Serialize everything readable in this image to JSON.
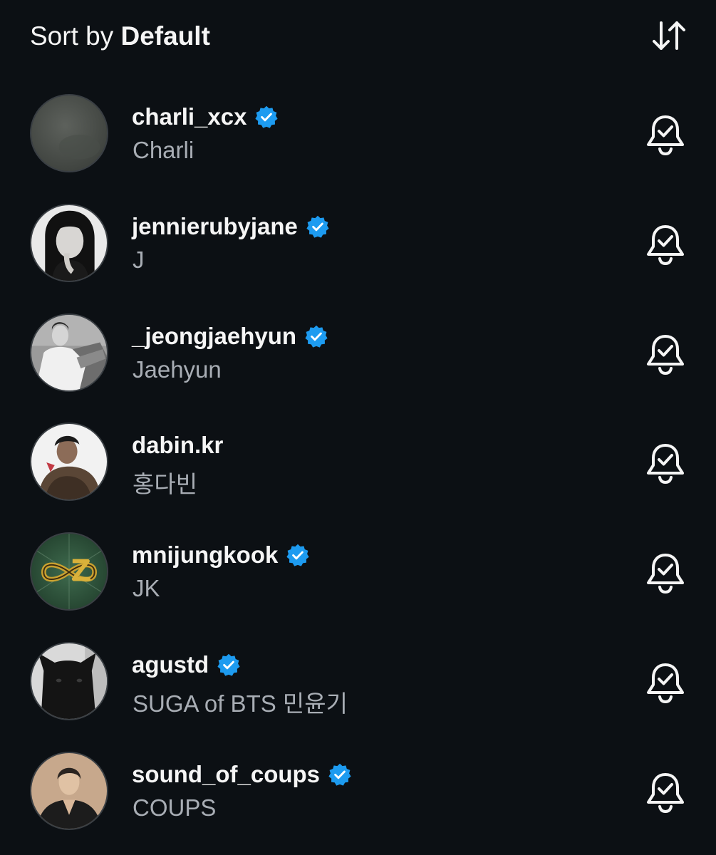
{
  "sort": {
    "prefix": "Sort by",
    "value": "Default",
    "toggle_icon": "sort-arrows-icon"
  },
  "colors": {
    "background": "#0c1014",
    "text_primary": "#f5f5f5",
    "text_secondary": "#a8adb4",
    "verified_blue": "#1d9bf0"
  },
  "accounts": [
    {
      "username": "charli_xcx",
      "full_name": "Charli",
      "verified": true,
      "notifications_icon": "bell-check-icon"
    },
    {
      "username": "jennierubyjane",
      "full_name": "J",
      "verified": true,
      "notifications_icon": "bell-check-icon"
    },
    {
      "username": "_jeongjaehyun",
      "full_name": "Jaehyun",
      "verified": true,
      "notifications_icon": "bell-check-icon"
    },
    {
      "username": "dabin.kr",
      "full_name": "홍다빈",
      "verified": false,
      "notifications_icon": "bell-check-icon"
    },
    {
      "username": "mnijungkook",
      "full_name": "JK",
      "verified": true,
      "notifications_icon": "bell-check-icon"
    },
    {
      "username": "agustd",
      "full_name": "SUGA of BTS 민윤기",
      "verified": true,
      "notifications_icon": "bell-check-icon"
    },
    {
      "username": "sound_of_coups",
      "full_name": "COUPS",
      "verified": true,
      "notifications_icon": "bell-check-icon"
    }
  ]
}
